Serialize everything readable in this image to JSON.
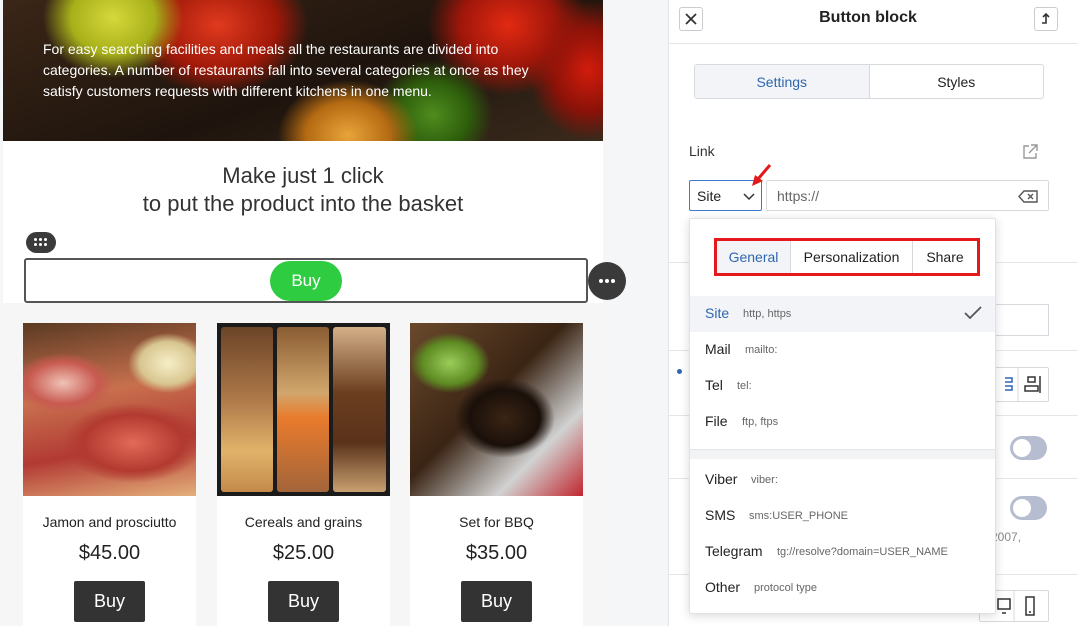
{
  "email": {
    "hero_text": "For easy searching facilities and meals all the restaurants are divided into categories. A number of restaurants fall into several categories at once as they satisfy customers requests with different kitchens in one menu.",
    "headline_line1": "Make just 1 click",
    "headline_line2": "to put the product into the basket",
    "button_label": "Buy",
    "button_color": "#2ecc40",
    "products": [
      {
        "name": "Jamon and prosciutto",
        "price": "$45.00",
        "buy_label": "Buy"
      },
      {
        "name": "Cereals and grains",
        "price": "$25.00",
        "buy_label": "Buy"
      },
      {
        "name": "Set for BBQ",
        "price": "$35.00",
        "buy_label": "Buy"
      }
    ]
  },
  "panel": {
    "title": "Button block",
    "tabs": [
      {
        "label": "Settings",
        "active": true
      },
      {
        "label": "Styles",
        "active": false
      }
    ],
    "link_label": "Link",
    "scheme_value": "Site",
    "url_placeholder": "https://",
    "background_text": "2007,",
    "dropdown": {
      "tabs": [
        {
          "label": "General",
          "active": true
        },
        {
          "label": "Personalization",
          "active": false
        },
        {
          "label": "Share",
          "active": false
        }
      ],
      "items": [
        {
          "name": "Site",
          "hint": "http, https",
          "selected": true
        },
        {
          "name": "Mail",
          "hint": "mailto:",
          "selected": false
        },
        {
          "name": "Tel",
          "hint": "tel:",
          "selected": false
        },
        {
          "name": "File",
          "hint": "ftp, ftps",
          "selected": false
        },
        {
          "name": "Viber",
          "hint": "viber:",
          "selected": false
        },
        {
          "name": "SMS",
          "hint": "sms:USER_PHONE",
          "selected": false
        },
        {
          "name": "Telegram",
          "hint": "tg://resolve?domain=USER_NAME",
          "selected": false
        },
        {
          "name": "Other",
          "hint": "protocol type",
          "selected": false
        }
      ]
    },
    "accent_color": "#2f66b0",
    "highlight_color": "#e5191b"
  },
  "icons": [
    "close-icon",
    "collapse-icon",
    "external-link-icon",
    "chevron-down-icon",
    "clear-input-icon",
    "checkmark-icon",
    "drag-handle-icon",
    "more-options-icon",
    "red-arrow-annotation"
  ]
}
